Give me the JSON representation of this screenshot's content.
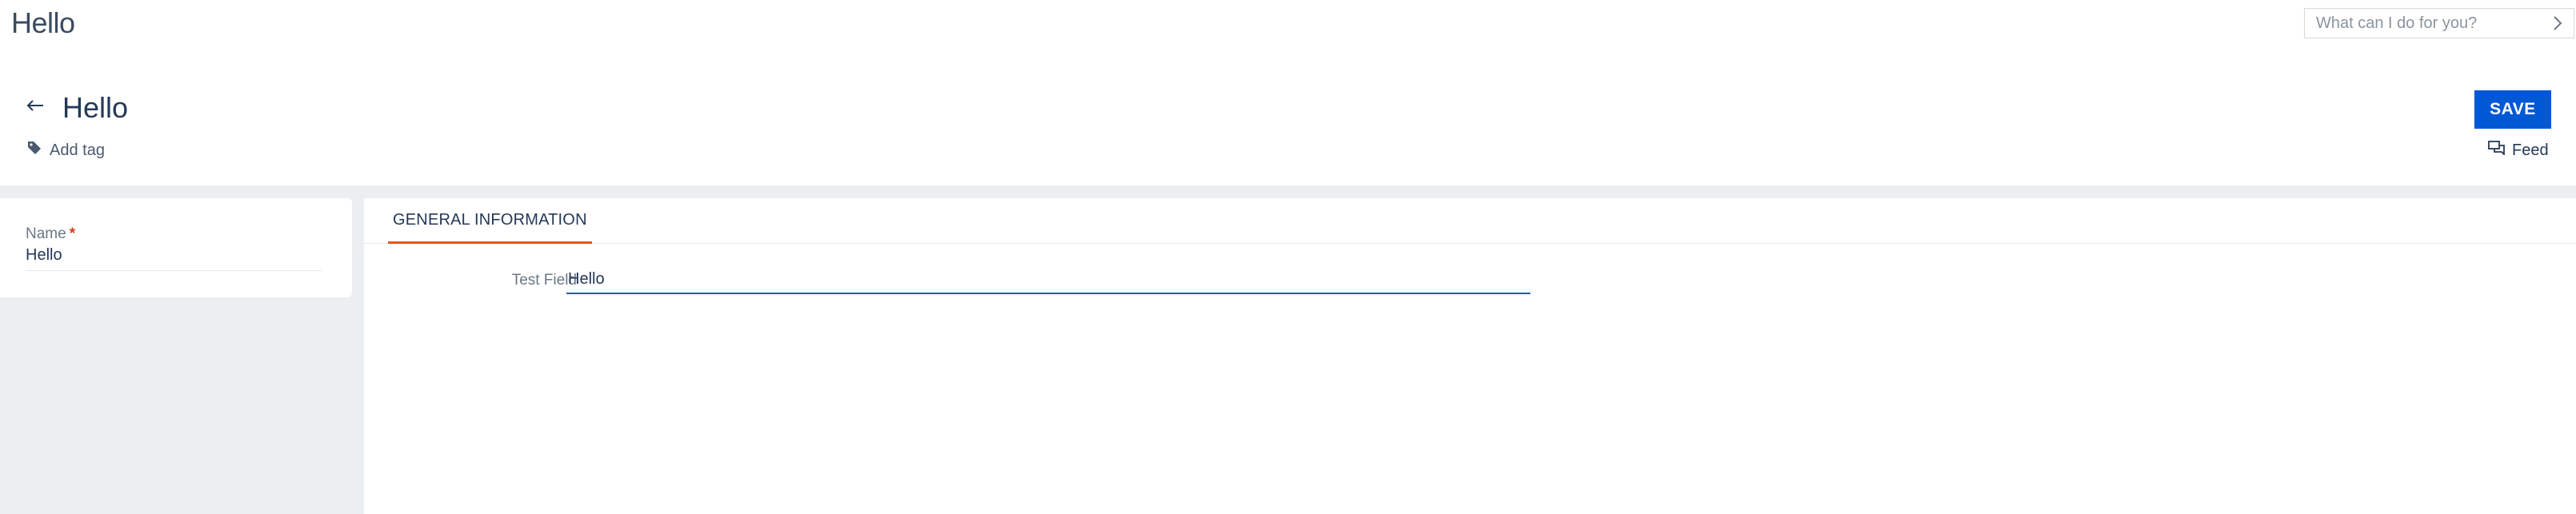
{
  "app": {
    "title": "Hello"
  },
  "command": {
    "placeholder": "What can I do for you?",
    "arrow_icon": "chevron-right-icon"
  },
  "record": {
    "title": "Hello",
    "back_icon": "arrow-left-icon",
    "save_label": "SAVE",
    "add_tag_label": "Add tag",
    "tag_icon": "tag-icon",
    "feed_label": "Feed",
    "feed_icon": "chat-bubbles-icon"
  },
  "left_panel": {
    "name_label": "Name",
    "required_marker": "*",
    "name_value": "Hello"
  },
  "tabs": [
    {
      "label": "GENERAL INFORMATION",
      "active": true
    }
  ],
  "general": {
    "test_field_label": "Test Field",
    "test_field_value": "Hello"
  },
  "colors": {
    "accent_blue": "#0058d4",
    "tab_underline": "#e8551c",
    "required": "#d23f1f",
    "body_background": "#eceff1"
  }
}
